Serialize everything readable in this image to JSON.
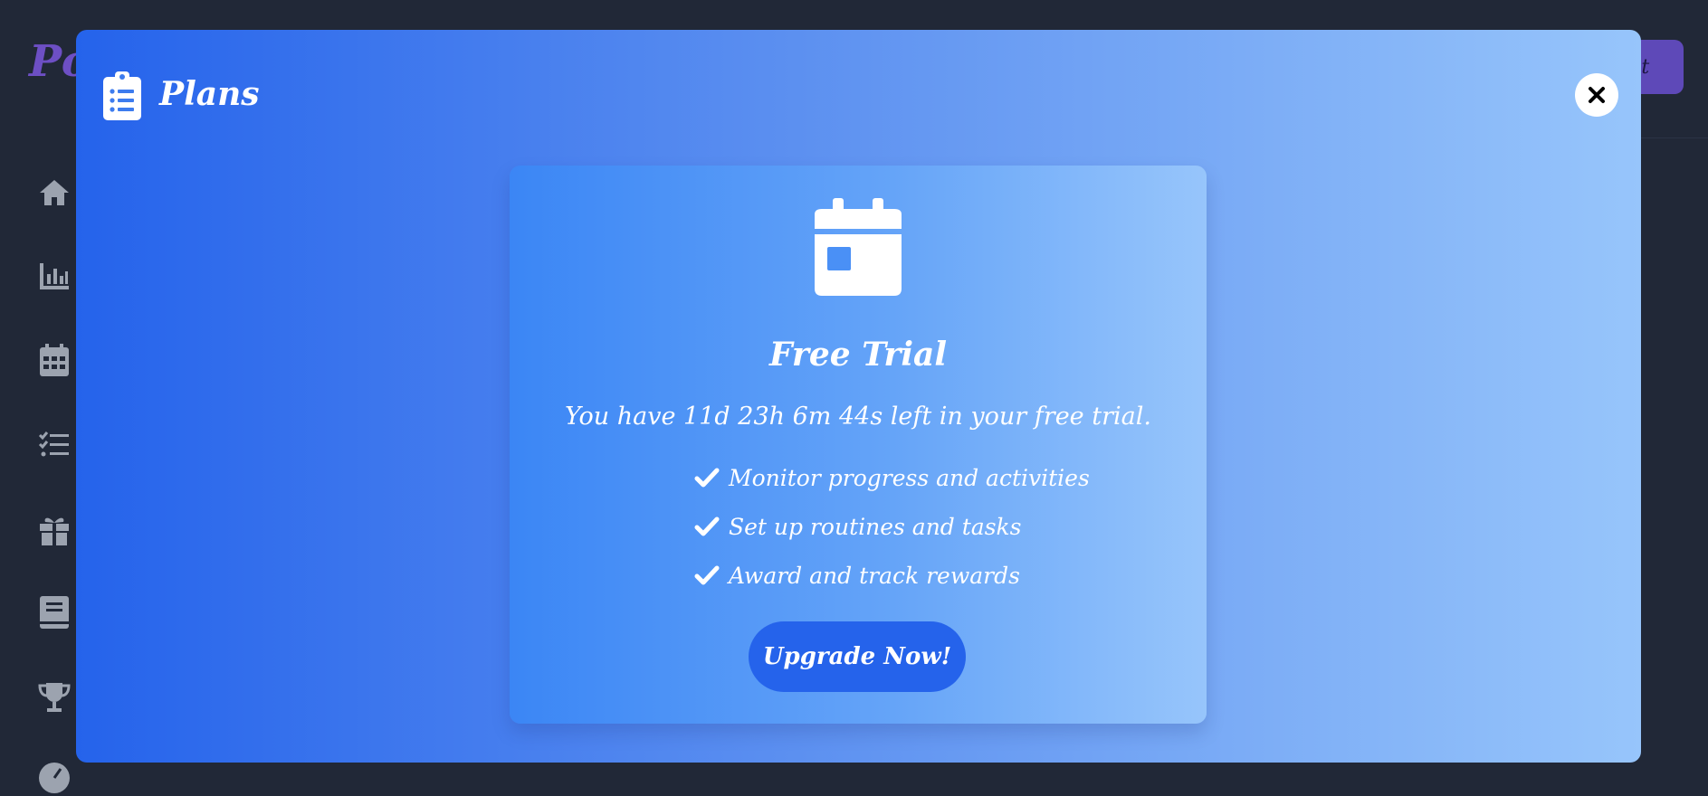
{
  "app": {
    "brand": "Po",
    "topbar_button_label": "out"
  },
  "sidebar": {
    "icons": [
      "home-icon",
      "chart-icon",
      "calendar-icon",
      "tasks-icon",
      "gift-icon",
      "book-icon",
      "trophy-icon",
      "gauge-icon"
    ]
  },
  "modal": {
    "title": "Plans",
    "header_icon": "clipboard-list-icon",
    "close_icon": "close-icon",
    "card": {
      "icon": "calendar-icon",
      "title": "Free Trial",
      "countdown": "You have 11d 23h 6m 44s left in your free trial.",
      "features": [
        "Monitor progress and activities",
        "Set up routines and tasks",
        "Award and track rewards"
      ],
      "button_label": "Upgrade Now!"
    }
  },
  "colors": {
    "page_bg": "#212837",
    "modal_gradient_start": "#2563eb",
    "modal_gradient_end": "#97c5fb",
    "button_bg": "#2563eb",
    "brand": "#6d4fc4",
    "sidebar_icon": "#9ca3af"
  }
}
